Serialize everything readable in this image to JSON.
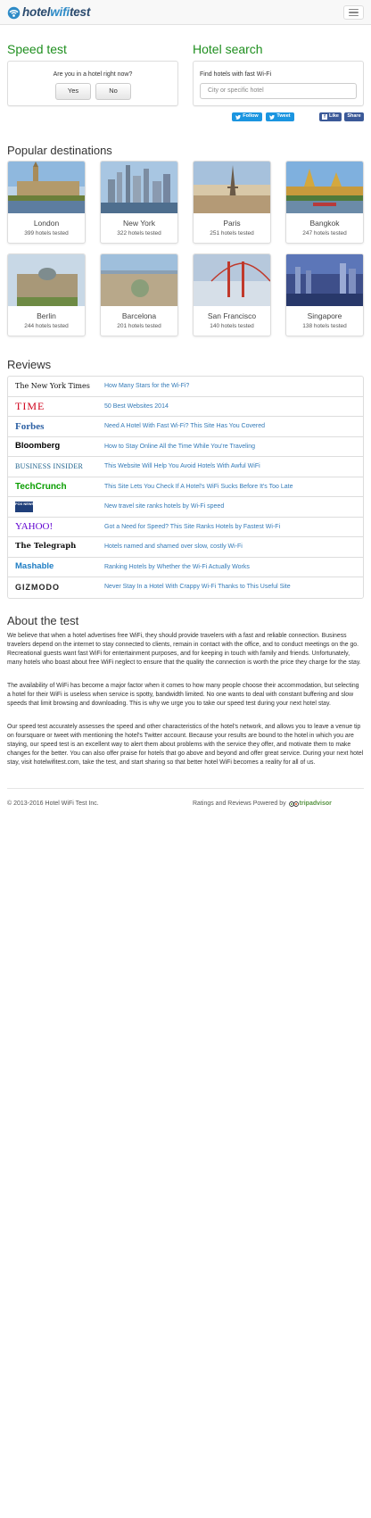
{
  "brand": {
    "name_part1": "hotel",
    "name_part2": "wifi",
    "name_part3": "test"
  },
  "speed_test": {
    "title": "Speed test",
    "question": "Are you in a hotel right now?",
    "yes_label": "Yes",
    "no_label": "No"
  },
  "hotel_search": {
    "title": "Hotel search",
    "label": "Find hotels with fast Wi-Fi",
    "placeholder": "City or specific hotel"
  },
  "social": {
    "follow": "Follow",
    "tweet": "Tweet",
    "like": "Like",
    "share": "Share"
  },
  "destinations": {
    "title": "Popular destinations",
    "items": [
      {
        "city": "London",
        "count": "399 hotels tested"
      },
      {
        "city": "New York",
        "count": "322 hotels tested"
      },
      {
        "city": "Paris",
        "count": "251 hotels tested"
      },
      {
        "city": "Bangkok",
        "count": "247 hotels tested"
      },
      {
        "city": "Berlin",
        "count": "244 hotels tested"
      },
      {
        "city": "Barcelona",
        "count": "201 hotels tested"
      },
      {
        "city": "San Francisco",
        "count": "140 hotels tested"
      },
      {
        "city": "Singapore",
        "count": "138 hotels tested"
      }
    ]
  },
  "reviews": {
    "title": "Reviews",
    "items": [
      {
        "source": "The New York Times",
        "headline": "How Many Stars for the Wi-Fi?"
      },
      {
        "source": "TIME",
        "headline": "50 Best Websites 2014"
      },
      {
        "source": "Forbes",
        "headline": "Need A Hotel With Fast Wi-Fi? This Site Has You Covered"
      },
      {
        "source": "Bloomberg",
        "headline": "How to Stay Online All the Time While You're Traveling"
      },
      {
        "source": "BUSINESS INSIDER",
        "headline": "This Website Will Help You Avoid Hotels With Awful WiFi"
      },
      {
        "source": "TechCrunch",
        "headline": "This Site Lets You Check If A Hotel's WiFi Sucks Before It's Too Late"
      },
      {
        "source": "FOX NEWS",
        "headline": "New travel site ranks hotels by Wi-Fi speed"
      },
      {
        "source": "YAHOO!",
        "headline": "Got a Need for Speed? This Site Ranks Hotels by Fastest Wi-Fi"
      },
      {
        "source": "The Telegraph",
        "headline": "Hotels named and shamed over slow, costly Wi-Fi"
      },
      {
        "source": "Mashable",
        "headline": "Ranking Hotels by Whether the Wi-Fi Actually Works"
      },
      {
        "source": "GIZMODO",
        "headline": "Never Stay In a Hotel With Crappy Wi-Fi Thanks to This Useful Site"
      }
    ]
  },
  "about": {
    "title": "About the test",
    "p1": "We believe that when a hotel advertises free WiFi, they should provide travelers with a fast and reliable connection. Business travelers depend on the internet to stay connected to clients, remain in contact with the office, and to conduct meetings on the go. Recreational guests want fast WiFi for entertainment purposes, and for keeping in touch with family and friends. Unfortunately, many hotels who boast about free WiFi neglect to ensure that the quality the connection is worth the price they charge for the stay.",
    "p2": "The availability of WiFi has become a major factor when it comes to how many people choose their accommodation, but selecting a hotel for their WiFi is useless when service is spotty, bandwidth limited. No one wants to deal with constant buffering and slow speeds that limit browsing and downloading. This is why we urge you to take our speed test during your next hotel stay.",
    "p3": "Our speed test accurately assesses the speed and other characteristics of the hotel's network, and allows you to leave a venue tip on foursquare or tweet with mentioning the hotel's Twitter account. Because your results are bound to the hotel in which you are staying, our speed test is an excellent way to alert them about problems with the service they offer, and motivate them to make changes for the better. You can also offer praise for hotels that go above and beyond and offer great service. During your next hotel stay, visit hotelwifitest.com, take the test, and start sharing so that better hotel WiFi becomes a reality for all of us."
  },
  "footer": {
    "copyright": "© 2013-2016 Hotel WiFi Test Inc.",
    "powered": "Ratings and Reviews Powered by",
    "tripadvisor": "tripadvisor"
  },
  "colors": {
    "heading_green": "#1f8f1f",
    "link_blue": "#337ab7",
    "twitter": "#1b95e0",
    "facebook": "#3b5998"
  }
}
